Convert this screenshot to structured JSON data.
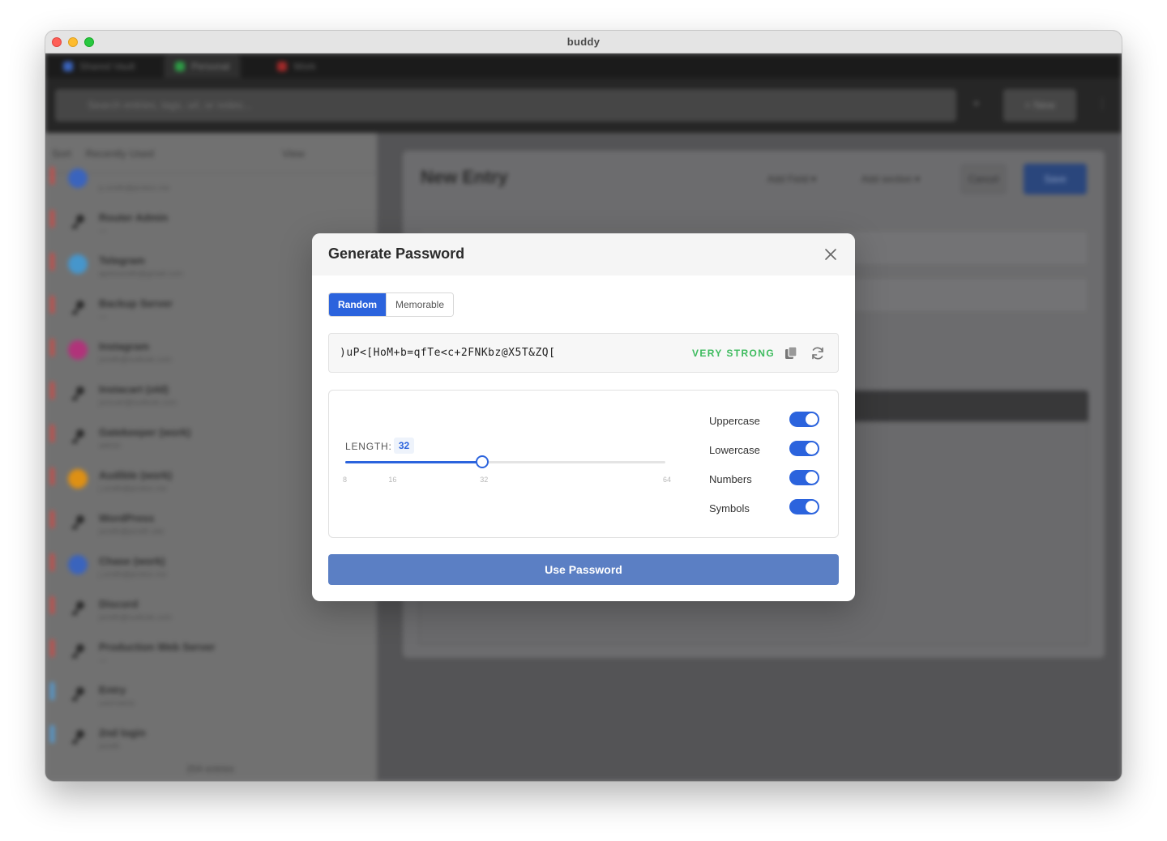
{
  "window": {
    "title": "buddy"
  },
  "background": {
    "tabs": [
      "Shared Vault",
      "Personal",
      "Work"
    ],
    "search_placeholder": "Search entries, tags, url, or notes...",
    "new_button": "+ New",
    "sort": {
      "label": "Sort",
      "value": "Recently Used",
      "view_label": "View"
    },
    "entries": [
      {
        "name": "",
        "sub": "p.smith@proton.me",
        "bar": "#d9534f",
        "icon": "#3d6bcf"
      },
      {
        "name": "Router Admin",
        "sub": "—",
        "bar": "#d9534f",
        "icon": "key"
      },
      {
        "name": "Telegram",
        "sub": "ajohnsmith@gmail.com",
        "bar": "#d9534f",
        "icon": "#4aa3df"
      },
      {
        "name": "Backup Server",
        "sub": "—",
        "bar": "#d9534f",
        "icon": "key"
      },
      {
        "name": "Instagram",
        "sub": "jsmith@outlook.com",
        "bar": "#d9534f",
        "icon": "#c13584"
      },
      {
        "name": "Instacart (old)",
        "sub": "jsmcart@outlook.com",
        "bar": "#d9534f",
        "icon": "key"
      },
      {
        "name": "Gatekeeper (work)",
        "sub": "admin",
        "bar": "#d9534f",
        "icon": "key"
      },
      {
        "name": "Audible (work)",
        "sub": "j.smith@proton.me",
        "bar": "#d9534f",
        "icon": "#f39c12"
      },
      {
        "name": "WordPress",
        "sub": "jsmith@jsmith.site",
        "bar": "#d9534f",
        "icon": "key"
      },
      {
        "name": "Chase (work)",
        "sub": "j.smith@proton.me",
        "bar": "#d9534f",
        "icon": "#3d6bcf"
      },
      {
        "name": "Discord",
        "sub": "jsmith@outlook.com",
        "bar": "#d9534f",
        "icon": "key"
      },
      {
        "name": "Production Web Server",
        "sub": "—",
        "bar": "#d9534f",
        "icon": "key"
      },
      {
        "name": "Entry",
        "sub": "username",
        "bar": "#5aa9e6",
        "icon": "key"
      },
      {
        "name": "2nd login",
        "sub": "jsmith",
        "bar": "#5aa9e6",
        "icon": "key"
      }
    ],
    "entry_count": "204 entries",
    "card": {
      "title": "New Entry",
      "add_field": "Add Field ▾",
      "add_section": "Add section ▾",
      "cancel": "Cancel",
      "save": "Save"
    }
  },
  "modal": {
    "title": "Generate Password",
    "modes": [
      "Random",
      "Memorable"
    ],
    "active_mode": "Random",
    "password": ")uP<[HoM+b=qfTe<c+2FNKbz@X5T&ZQ[",
    "strength": "VERY STRONG",
    "length": {
      "label": "LENGTH:",
      "value": "32",
      "min": 8,
      "max": 64,
      "current": 32,
      "ticks": [
        "8",
        "16",
        "32",
        "64"
      ]
    },
    "options": [
      {
        "label": "Uppercase",
        "enabled": true
      },
      {
        "label": "Lowercase",
        "enabled": true
      },
      {
        "label": "Numbers",
        "enabled": true
      },
      {
        "label": "Symbols",
        "enabled": true
      }
    ],
    "use_button": "Use Password"
  },
  "colors": {
    "accent": "#2b63dd",
    "strength_green": "#3dbb5e",
    "use_button": "#5b7fc4"
  },
  "icons": {
    "close": "close-icon",
    "copy": "copy-icon",
    "regenerate": "refresh-icon"
  }
}
